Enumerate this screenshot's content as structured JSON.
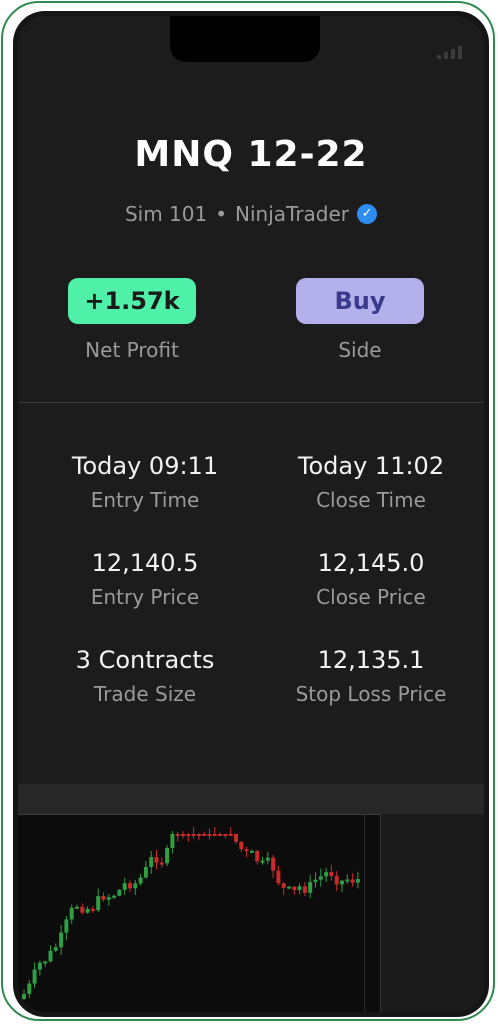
{
  "trade": {
    "symbol": "MNQ 12-22",
    "account": "Sim 101",
    "separator": "•",
    "platform": "NinjaTrader",
    "verified_icon": "✓"
  },
  "badges": {
    "net_profit_value": "+1.57k",
    "net_profit_label": "Net Profit",
    "side_value": "Buy",
    "side_label": "Side"
  },
  "stats": [
    {
      "value": "Today 09:11",
      "label": "Entry Time"
    },
    {
      "value": "Today 11:02",
      "label": "Close Time"
    },
    {
      "value": "12,140.5",
      "label": "Entry Price"
    },
    {
      "value": "12,145.0",
      "label": "Close Price"
    },
    {
      "value": "3 Contracts",
      "label": "Trade Size"
    },
    {
      "value": "12,135.1",
      "label": "Stop Loss Price"
    }
  ],
  "colors": {
    "profit_badge": "#4ff0a7",
    "side_badge": "#b3b0ec",
    "verified": "#2d8cf0",
    "frame": "#2e8b4e",
    "candle_up": "#2f9e44",
    "candle_down": "#c92a2a"
  },
  "icons": {
    "signal": "signal-bars-icon",
    "verified": "verified-check-icon"
  }
}
